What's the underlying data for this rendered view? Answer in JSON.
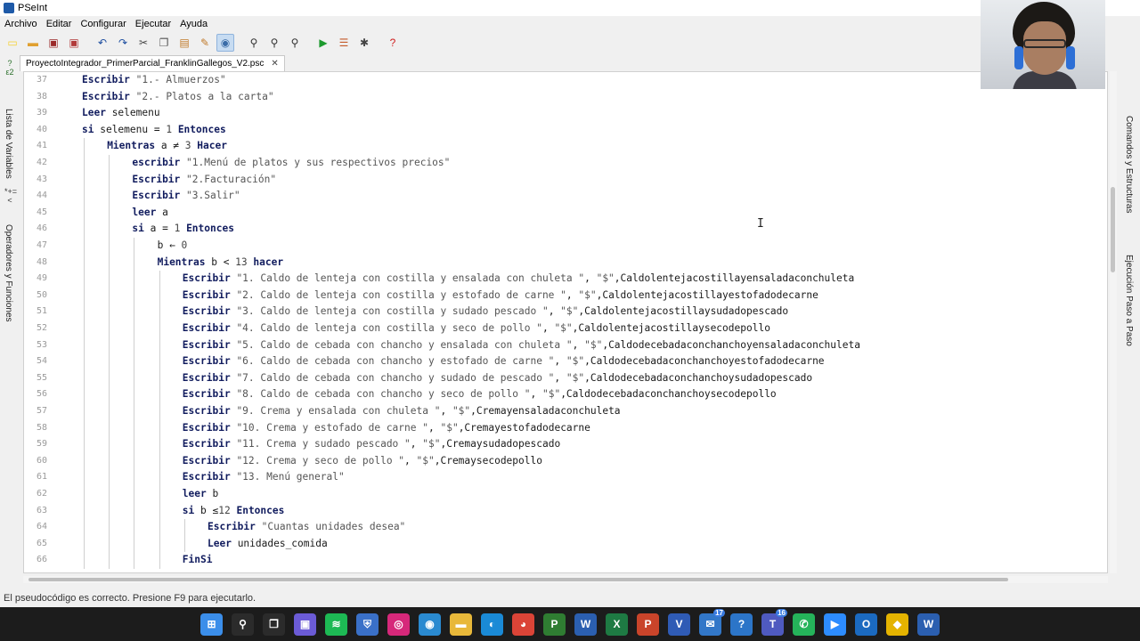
{
  "window": {
    "title": "PSeInt"
  },
  "menu": [
    "Archivo",
    "Editar",
    "Configurar",
    "Ejecutar",
    "Ayuda"
  ],
  "toolbar": [
    {
      "name": "new-file-icon",
      "glyph": "▭",
      "color": "#f5d033"
    },
    {
      "name": "open-file-icon",
      "glyph": "▬",
      "color": "#e0a030"
    },
    {
      "name": "save-icon",
      "glyph": "▣",
      "color": "#9b2a2a"
    },
    {
      "name": "save-as-icon",
      "glyph": "▣",
      "color": "#b23a3a"
    },
    {
      "name": "sep"
    },
    {
      "name": "undo-icon",
      "glyph": "↶",
      "color": "#1f4fa0"
    },
    {
      "name": "redo-icon",
      "glyph": "↷",
      "color": "#1f4fa0"
    },
    {
      "name": "cut-icon",
      "glyph": "✂",
      "color": "#444"
    },
    {
      "name": "copy-icon",
      "glyph": "❐",
      "color": "#555"
    },
    {
      "name": "paste-icon",
      "glyph": "▤",
      "color": "#c07a2a"
    },
    {
      "name": "edit-icon",
      "glyph": "✎",
      "color": "#c07a2a"
    },
    {
      "name": "view-icon",
      "glyph": "◉",
      "color": "#3a6ca8",
      "active": true
    },
    {
      "name": "sep"
    },
    {
      "name": "search-icon",
      "glyph": "⚲",
      "color": "#333"
    },
    {
      "name": "search-next-icon",
      "glyph": "⚲",
      "color": "#333"
    },
    {
      "name": "replace-icon",
      "glyph": "⚲",
      "color": "#333"
    },
    {
      "name": "sep"
    },
    {
      "name": "run-icon",
      "glyph": "▶",
      "color": "#1d9a2e"
    },
    {
      "name": "step-icon",
      "glyph": "☰",
      "color": "#c45a2a"
    },
    {
      "name": "debug-icon",
      "glyph": "✱",
      "color": "#444"
    },
    {
      "name": "sep"
    },
    {
      "name": "help-icon",
      "glyph": "?",
      "color": "#d02020"
    }
  ],
  "tab": {
    "label": "ProyectoIntegrador_PrimerParcial_FranklinGallegos_V2.psc",
    "close": "✕"
  },
  "left_panels": [
    "Lista de Variables",
    "Operadores y Funciones"
  ],
  "left_icons": [
    "*+=<",
    "?ε2"
  ],
  "right_panels": [
    "Comandos y Estructuras",
    "Ejecución Paso a Paso"
  ],
  "code": [
    {
      "n": "37",
      "indent": 0,
      "t": [
        [
          "kw",
          "Escribir"
        ],
        [
          "",
          " "
        ],
        [
          "str",
          "\"1.- Almuerzos\""
        ]
      ]
    },
    {
      "n": "38",
      "indent": 0,
      "t": [
        [
          "kw",
          "Escribir"
        ],
        [
          "",
          " "
        ],
        [
          "str",
          "\"2.- Platos a la carta\""
        ]
      ]
    },
    {
      "n": "39",
      "indent": 0,
      "t": [
        [
          "kw",
          "Leer"
        ],
        [
          "",
          " selemenu"
        ]
      ]
    },
    {
      "n": "40",
      "indent": 0,
      "t": [
        [
          "kw",
          "si"
        ],
        [
          "",
          " selemenu = "
        ],
        [
          "num",
          "1"
        ],
        [
          "",
          " "
        ],
        [
          "kw",
          "Entonces"
        ]
      ]
    },
    {
      "n": "41",
      "indent": 1,
      "t": [
        [
          "kw",
          "Mientras"
        ],
        [
          "",
          " a ≠ "
        ],
        [
          "num",
          "3"
        ],
        [
          "",
          " "
        ],
        [
          "kw",
          "Hacer"
        ]
      ]
    },
    {
      "n": "42",
      "indent": 2,
      "t": [
        [
          "kw",
          "escribir"
        ],
        [
          "",
          " "
        ],
        [
          "str",
          "\"1.Menú de platos y sus respectivos precios\""
        ]
      ]
    },
    {
      "n": "43",
      "indent": 2,
      "t": [
        [
          "kw",
          "Escribir"
        ],
        [
          "",
          " "
        ],
        [
          "str",
          "\"2.Facturación\""
        ]
      ]
    },
    {
      "n": "44",
      "indent": 2,
      "t": [
        [
          "kw",
          "Escribir"
        ],
        [
          "",
          " "
        ],
        [
          "str",
          "\"3.Salir\""
        ]
      ]
    },
    {
      "n": "45",
      "indent": 2,
      "t": [
        [
          "kw",
          "leer"
        ],
        [
          "",
          " a"
        ]
      ]
    },
    {
      "n": "46",
      "indent": 2,
      "t": [
        [
          "kw",
          "si"
        ],
        [
          "",
          " a = "
        ],
        [
          "num",
          "1"
        ],
        [
          "",
          " "
        ],
        [
          "kw",
          "Entonces"
        ]
      ]
    },
    {
      "n": "47",
      "indent": 3,
      "t": [
        [
          "",
          "b ← "
        ],
        [
          "num",
          "0"
        ]
      ]
    },
    {
      "n": "48",
      "indent": 3,
      "t": [
        [
          "kw",
          "Mientras"
        ],
        [
          "",
          " b < "
        ],
        [
          "num",
          "13"
        ],
        [
          "",
          " "
        ],
        [
          "kw",
          "hacer"
        ]
      ]
    },
    {
      "n": "49",
      "indent": 4,
      "t": [
        [
          "kw",
          "Escribir"
        ],
        [
          "",
          " "
        ],
        [
          "str",
          "\"1. Caldo de lenteja con costilla y ensalada con chuleta \""
        ],
        [
          "",
          ", "
        ],
        [
          "str",
          "\"$\""
        ],
        [
          "",
          ",Caldolentejacostillayensaladaconchuleta"
        ]
      ]
    },
    {
      "n": "50",
      "indent": 4,
      "t": [
        [
          "kw",
          "Escribir"
        ],
        [
          "",
          " "
        ],
        [
          "str",
          "\"2. Caldo de lenteja con costilla y estofado de carne \""
        ],
        [
          "",
          ", "
        ],
        [
          "str",
          "\"$\""
        ],
        [
          "",
          ",Caldolentejacostillayestofadodecarne"
        ]
      ]
    },
    {
      "n": "51",
      "indent": 4,
      "t": [
        [
          "kw",
          "Escribir"
        ],
        [
          "",
          " "
        ],
        [
          "str",
          "\"3. Caldo de lenteja con costilla y sudado pescado \""
        ],
        [
          "",
          ", "
        ],
        [
          "str",
          "\"$\""
        ],
        [
          "",
          ",Caldolentejacostillaysudadopescado"
        ]
      ]
    },
    {
      "n": "52",
      "indent": 4,
      "t": [
        [
          "kw",
          "Escribir"
        ],
        [
          "",
          " "
        ],
        [
          "str",
          "\"4. Caldo de lenteja con costilla y seco de pollo \""
        ],
        [
          "",
          ", "
        ],
        [
          "str",
          "\"$\""
        ],
        [
          "",
          ",Caldolentejacostillaysecodepollo"
        ]
      ]
    },
    {
      "n": "53",
      "indent": 4,
      "t": [
        [
          "kw",
          "Escribir"
        ],
        [
          "",
          " "
        ],
        [
          "str",
          "\"5. Caldo de cebada con chancho y ensalada con chuleta \""
        ],
        [
          "",
          ", "
        ],
        [
          "str",
          "\"$\""
        ],
        [
          "",
          ",Caldodecebadaconchanchoyensaladaconchuleta"
        ]
      ]
    },
    {
      "n": "54",
      "indent": 4,
      "t": [
        [
          "kw",
          "Escribir"
        ],
        [
          "",
          " "
        ],
        [
          "str",
          "\"6. Caldo de cebada con chancho y estofado de carne \""
        ],
        [
          "",
          ", "
        ],
        [
          "str",
          "\"$\""
        ],
        [
          "",
          ",Caldodecebadaconchanchoyestofadodecarne"
        ]
      ]
    },
    {
      "n": "55",
      "indent": 4,
      "t": [
        [
          "kw",
          "Escribir"
        ],
        [
          "",
          " "
        ],
        [
          "str",
          "\"7. Caldo de cebada con chancho y sudado de pescado \""
        ],
        [
          "",
          ", "
        ],
        [
          "str",
          "\"$\""
        ],
        [
          "",
          ",Caldodecebadaconchanchoysudadopescado"
        ]
      ]
    },
    {
      "n": "56",
      "indent": 4,
      "t": [
        [
          "kw",
          "Escribir"
        ],
        [
          "",
          " "
        ],
        [
          "str",
          "\"8. Caldo de cebada con chancho y seco de pollo \""
        ],
        [
          "",
          ", "
        ],
        [
          "str",
          "\"$\""
        ],
        [
          "",
          ",Caldodecebadaconchanchoysecodepollo"
        ]
      ]
    },
    {
      "n": "57",
      "indent": 4,
      "t": [
        [
          "kw",
          "Escribir"
        ],
        [
          "",
          " "
        ],
        [
          "str",
          "\"9. Crema y ensalada con chuleta \""
        ],
        [
          "",
          ", "
        ],
        [
          "str",
          "\"$\""
        ],
        [
          "",
          ",Cremayensaladaconchuleta"
        ]
      ]
    },
    {
      "n": "58",
      "indent": 4,
      "t": [
        [
          "kw",
          "Escribir"
        ],
        [
          "",
          " "
        ],
        [
          "str",
          "\"10. Crema y estofado de carne \""
        ],
        [
          "",
          ", "
        ],
        [
          "str",
          "\"$\""
        ],
        [
          "",
          ",Cremayestofadodecarne"
        ]
      ]
    },
    {
      "n": "59",
      "indent": 4,
      "t": [
        [
          "kw",
          "Escribir"
        ],
        [
          "",
          " "
        ],
        [
          "str",
          "\"11. Crema y sudado pescado \""
        ],
        [
          "",
          ", "
        ],
        [
          "str",
          "\"$\""
        ],
        [
          "",
          ",Cremaysudadopescado"
        ]
      ]
    },
    {
      "n": "60",
      "indent": 4,
      "t": [
        [
          "kw",
          "Escribir"
        ],
        [
          "",
          " "
        ],
        [
          "str",
          "\"12. Crema y seco de pollo \""
        ],
        [
          "",
          ", "
        ],
        [
          "str",
          "\"$\""
        ],
        [
          "",
          ",Cremaysecodepollo"
        ]
      ]
    },
    {
      "n": "61",
      "indent": 4,
      "t": [
        [
          "kw",
          "Escribir"
        ],
        [
          "",
          " "
        ],
        [
          "str",
          "\"13. Menú general\""
        ]
      ]
    },
    {
      "n": "62",
      "indent": 4,
      "t": [
        [
          "kw",
          "leer"
        ],
        [
          "",
          " b"
        ]
      ]
    },
    {
      "n": "63",
      "indent": 4,
      "t": [
        [
          "kw",
          "si"
        ],
        [
          "",
          " b ≤"
        ],
        [
          "num",
          "12"
        ],
        [
          "",
          " "
        ],
        [
          "kw",
          "Entonces"
        ]
      ]
    },
    {
      "n": "64",
      "indent": 5,
      "t": [
        [
          "kw",
          "Escribir"
        ],
        [
          "",
          " "
        ],
        [
          "str",
          "\"Cuantas unidades desea\""
        ]
      ]
    },
    {
      "n": "65",
      "indent": 5,
      "t": [
        [
          "kw",
          "Leer"
        ],
        [
          "",
          " unidades_comida"
        ]
      ]
    },
    {
      "n": "66",
      "indent": 4,
      "t": [
        [
          "kw",
          "FinSi"
        ]
      ]
    }
  ],
  "status": "El pseudocódigo es correcto. Presione F9 para ejecutarlo.",
  "taskbar": [
    {
      "name": "windows-start-icon",
      "glyph": "⊞",
      "color": "#3b8eea"
    },
    {
      "name": "search-icon",
      "glyph": "⚲",
      "color": "#2b2b2b"
    },
    {
      "name": "task-view-icon",
      "glyph": "❐",
      "color": "#2b2b2b"
    },
    {
      "name": "chat-icon",
      "glyph": "▣",
      "color": "#6b5bd6"
    },
    {
      "name": "spotify-icon",
      "glyph": "≋",
      "color": "#1db954"
    },
    {
      "name": "shield-icon",
      "glyph": "⛨",
      "color": "#3a70c8"
    },
    {
      "name": "instagram-icon",
      "glyph": "◎",
      "color": "#d6287a"
    },
    {
      "name": "browser-icon",
      "glyph": "◉",
      "color": "#2a8ad0"
    },
    {
      "name": "folder-icon",
      "glyph": "▬",
      "color": "#e8b83a"
    },
    {
      "name": "edge-icon",
      "glyph": "◐",
      "color": "#1a8ad6"
    },
    {
      "name": "chrome-icon",
      "glyph": "◕",
      "color": "#db4437"
    },
    {
      "name": "project-icon",
      "glyph": "P",
      "color": "#2f7d32"
    },
    {
      "name": "word-icon",
      "glyph": "W",
      "color": "#2b5fb0"
    },
    {
      "name": "excel-icon",
      "glyph": "X",
      "color": "#1e7a43"
    },
    {
      "name": "powerpoint-icon",
      "glyph": "P",
      "color": "#c9442a"
    },
    {
      "name": "visio-icon",
      "glyph": "V",
      "color": "#2f5bb5"
    },
    {
      "name": "mail-icon",
      "glyph": "✉",
      "color": "#3277c8",
      "badge": "17"
    },
    {
      "name": "app-icon",
      "glyph": "?",
      "color": "#2c75c8"
    },
    {
      "name": "teams-icon",
      "glyph": "T",
      "color": "#4f5ac0",
      "badge": "16"
    },
    {
      "name": "whatsapp-icon",
      "glyph": "✆",
      "color": "#25b35a"
    },
    {
      "name": "zoom-icon",
      "glyph": "▶",
      "color": "#2d8cff"
    },
    {
      "name": "outlook-icon",
      "glyph": "O",
      "color": "#1b6ac0"
    },
    {
      "name": "pseint-icon",
      "glyph": "◆",
      "color": "#e4b300"
    },
    {
      "name": "writer-icon",
      "glyph": "W",
      "color": "#2b5fb0"
    }
  ]
}
